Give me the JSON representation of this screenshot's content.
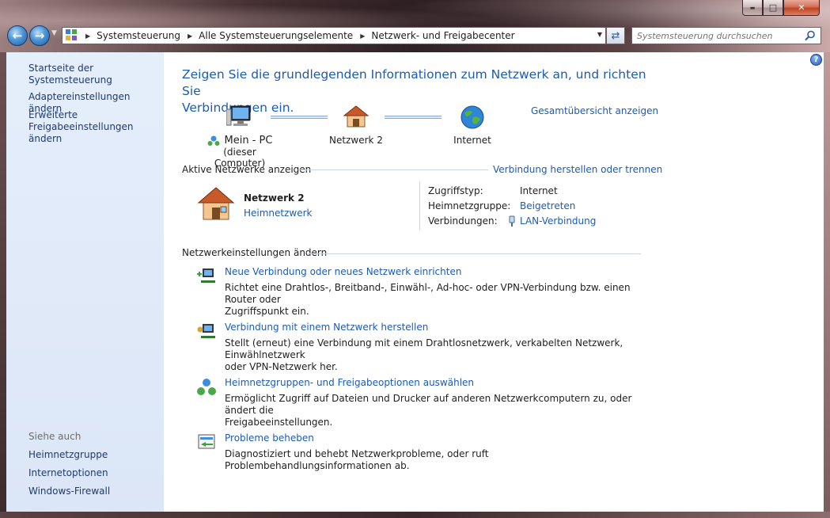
{
  "window": {
    "min_label": "▬",
    "max_label": "□",
    "close_label": "✕"
  },
  "address": {
    "crumbs": [
      "Systemsteuerung",
      "Alle Systemsteuerungselemente",
      "Netzwerk- und Freigabecenter"
    ],
    "search_placeholder": "Systemsteuerung durchsuchen"
  },
  "sidebar": {
    "links": [
      "Startseite der Systemsteuerung",
      "Adaptereinstellungen ändern",
      "Erweiterte",
      "Freigabeeinstellungen ändern"
    ],
    "see_also_heading": "Siehe auch",
    "see_also": [
      "Heimnetzgruppe",
      "Internetoptionen",
      "Windows-Firewall"
    ]
  },
  "main": {
    "title_line1": "Zeigen Sie die grundlegenden Informationen zum Netzwerk an, und richten Sie",
    "title_line2": "Verbindungen ein.",
    "overview_link": "Gesamtübersicht anzeigen",
    "map": {
      "computer_line1": "Mein - PC",
      "computer_line2": "(dieser Computer)",
      "network": "Netzwerk  2",
      "internet": "Internet"
    },
    "active_networks_heading": "Aktive Netzwerke anzeigen",
    "connect_link": "Verbindung herstellen oder trennen",
    "network": {
      "name": "Netzwerk  2",
      "type": "Heimnetzwerk",
      "access_type_label": "Zugriffstyp:",
      "access_type_value": "Internet",
      "homegroup_label": "Heimnetzgruppe:",
      "homegroup_value": "Beigetreten",
      "connections_label": "Verbindungen:",
      "connections_value": "LAN-Verbindung"
    },
    "change_settings_heading": "Netzwerkeinstellungen ändern",
    "tasks": [
      {
        "title": "Neue Verbindung oder neues Netzwerk einrichten",
        "desc_line1": "Richtet eine Drahtlos-, Breitband-, Einwähl-, Ad-hoc- oder VPN-Verbindung bzw. einen Router oder",
        "desc_line2": "Zugriffspunkt ein."
      },
      {
        "title": "Verbindung mit einem Netzwerk herstellen",
        "desc_line1": "Stellt (erneut) eine Verbindung mit einem Drahtlosnetzwerk, verkabelten Netzwerk, Einwählnetzwerk",
        "desc_line2": "oder VPN-Netzwerk her."
      },
      {
        "title": "Heimnetzgruppen- und Freigabeoptionen auswählen",
        "desc_line1": "Ermöglicht Zugriff auf Dateien und Drucker auf anderen Netzwerkcomputern zu, oder ändert die",
        "desc_line2": "Freigabeeinstellungen."
      },
      {
        "title": "Probleme beheben",
        "desc_line1": "Diagnostiziert und behebt Netzwerkprobleme, oder ruft Problembehandlungsinformationen ab.",
        "desc_line2": ""
      }
    ]
  }
}
